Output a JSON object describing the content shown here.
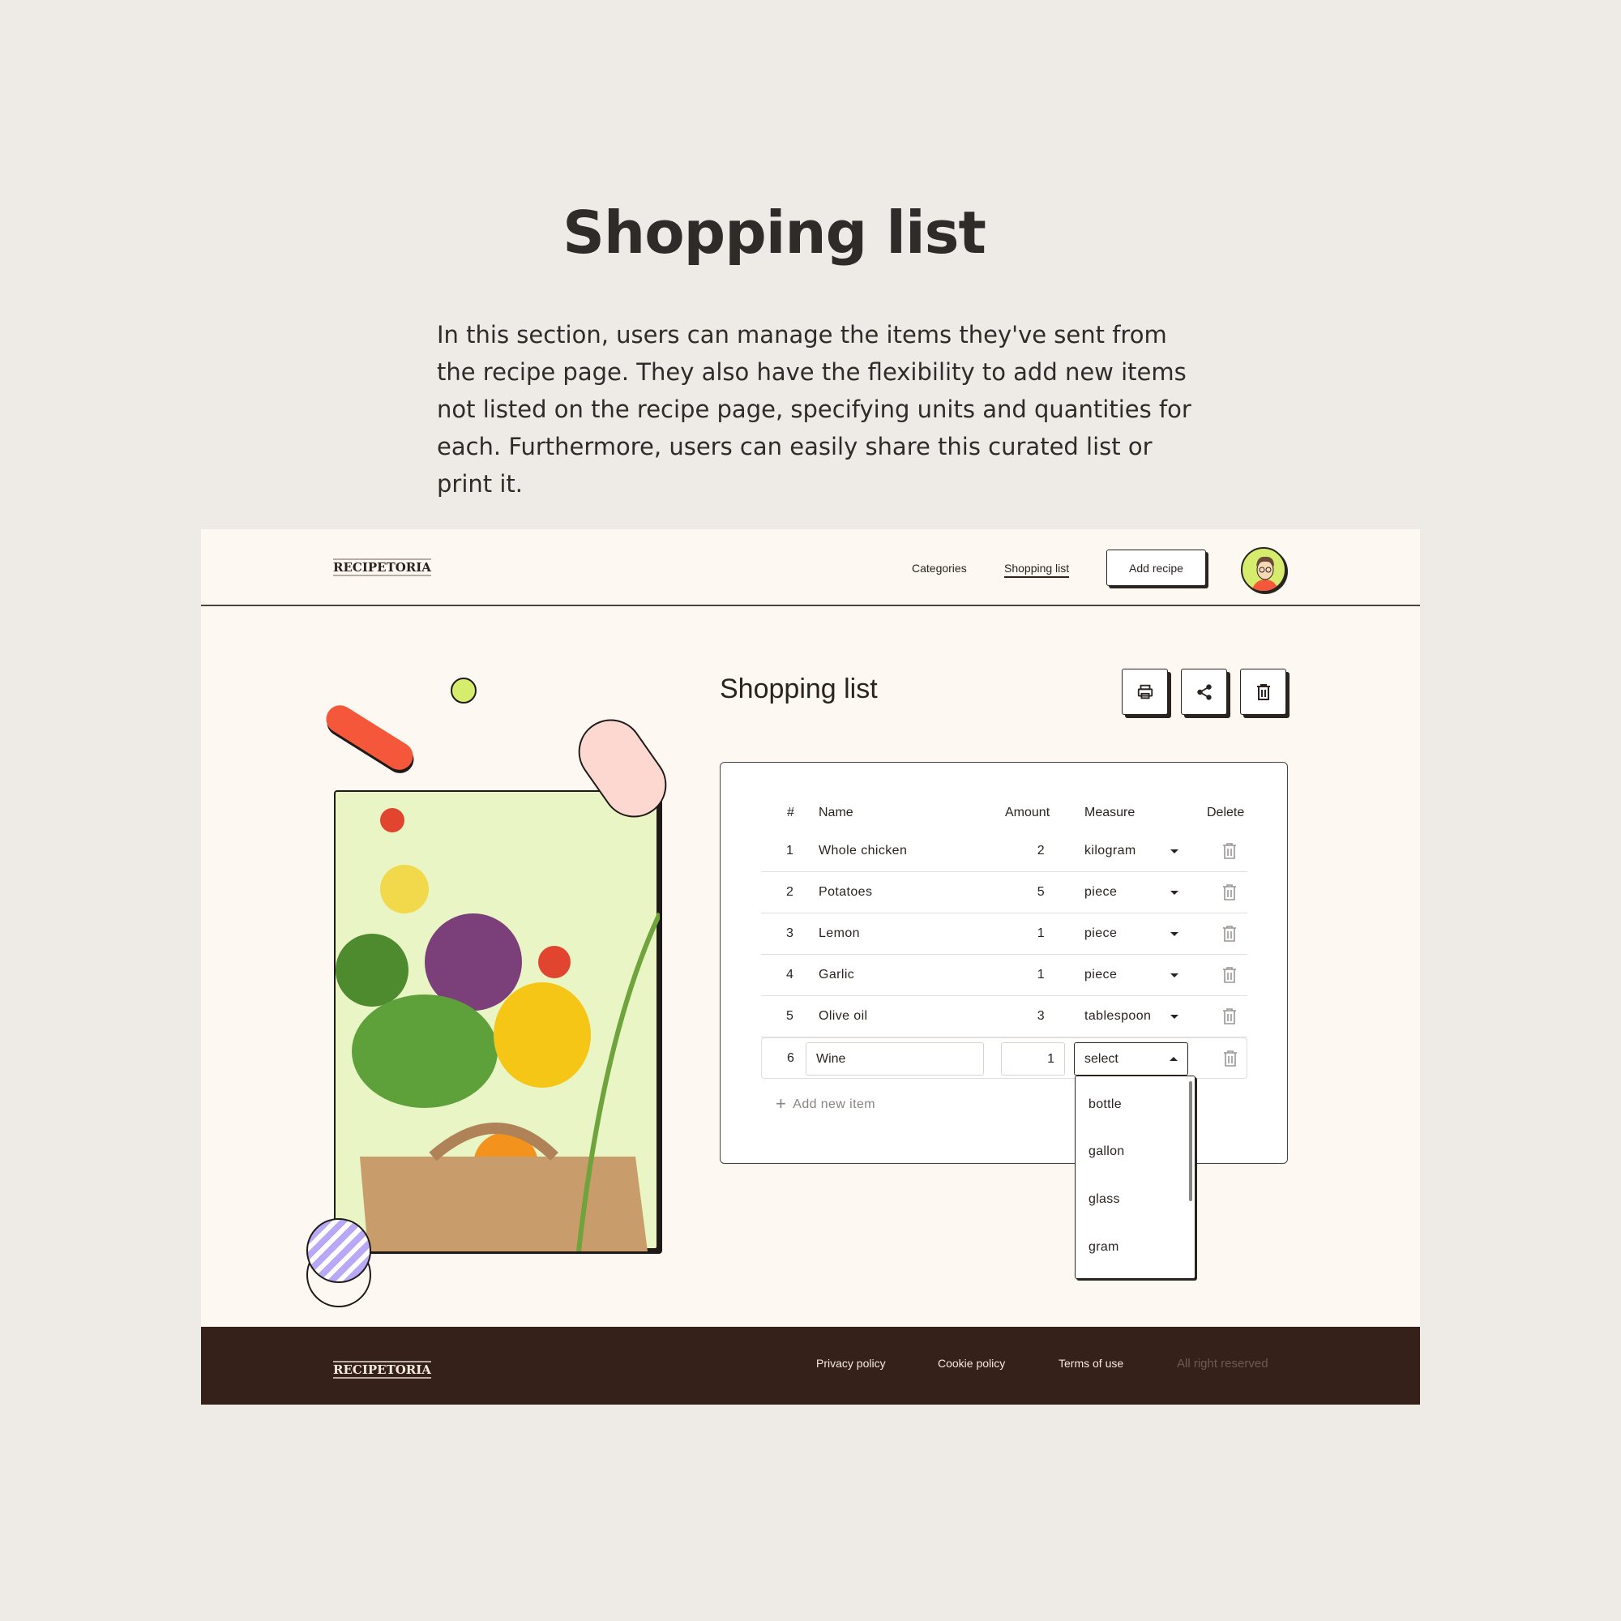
{
  "intro": {
    "title": "Shopping list",
    "description": "In this section, users can manage the items they've sent from the recipe page. They also have the flexibility to add new items not listed on the recipe page, specifying units and quantities for each. Furthermore, users can easily share this curated list or print it."
  },
  "nav": {
    "logo": "RECIPETORIA",
    "links": [
      "Categories",
      "Shopping list"
    ],
    "active": "Shopping list",
    "add_recipe": "Add recipe"
  },
  "main": {
    "heading": "Shopping list",
    "actions": [
      "print-icon",
      "share-icon",
      "trash-icon"
    ],
    "columns": [
      "#",
      "Name",
      "Amount",
      "Measure",
      "Delete"
    ],
    "rows": [
      {
        "n": "1",
        "name": "Whole chicken",
        "amount": "2",
        "measure": "kilogram"
      },
      {
        "n": "2",
        "name": "Potatoes",
        "amount": "5",
        "measure": "piece"
      },
      {
        "n": "3",
        "name": "Lemon",
        "amount": "1",
        "measure": "piece"
      },
      {
        "n": "4",
        "name": "Garlic",
        "amount": "1",
        "measure": "piece"
      },
      {
        "n": "5",
        "name": "Olive oil",
        "amount": "3",
        "measure": "tablespoon"
      }
    ],
    "editing": {
      "n": "6",
      "name": "Wine",
      "amount": "1",
      "measure": "select"
    },
    "add_item": "Add new item",
    "dropdown_options": [
      "bottle",
      "gallon",
      "glass",
      "gram"
    ]
  },
  "footer": {
    "logo": "RECIPETORIA",
    "links": [
      "Privacy policy",
      "Cookie policy",
      "Terms of use"
    ],
    "copyright": "All right reserved"
  },
  "colors": {
    "page_bg": "#eeebe6",
    "card_bg": "#fef8f3",
    "footer_bg": "#35201a",
    "accent_orange": "#f4573a",
    "accent_green": "#d6ec6c",
    "accent_lilac": "#b9a8f5"
  }
}
